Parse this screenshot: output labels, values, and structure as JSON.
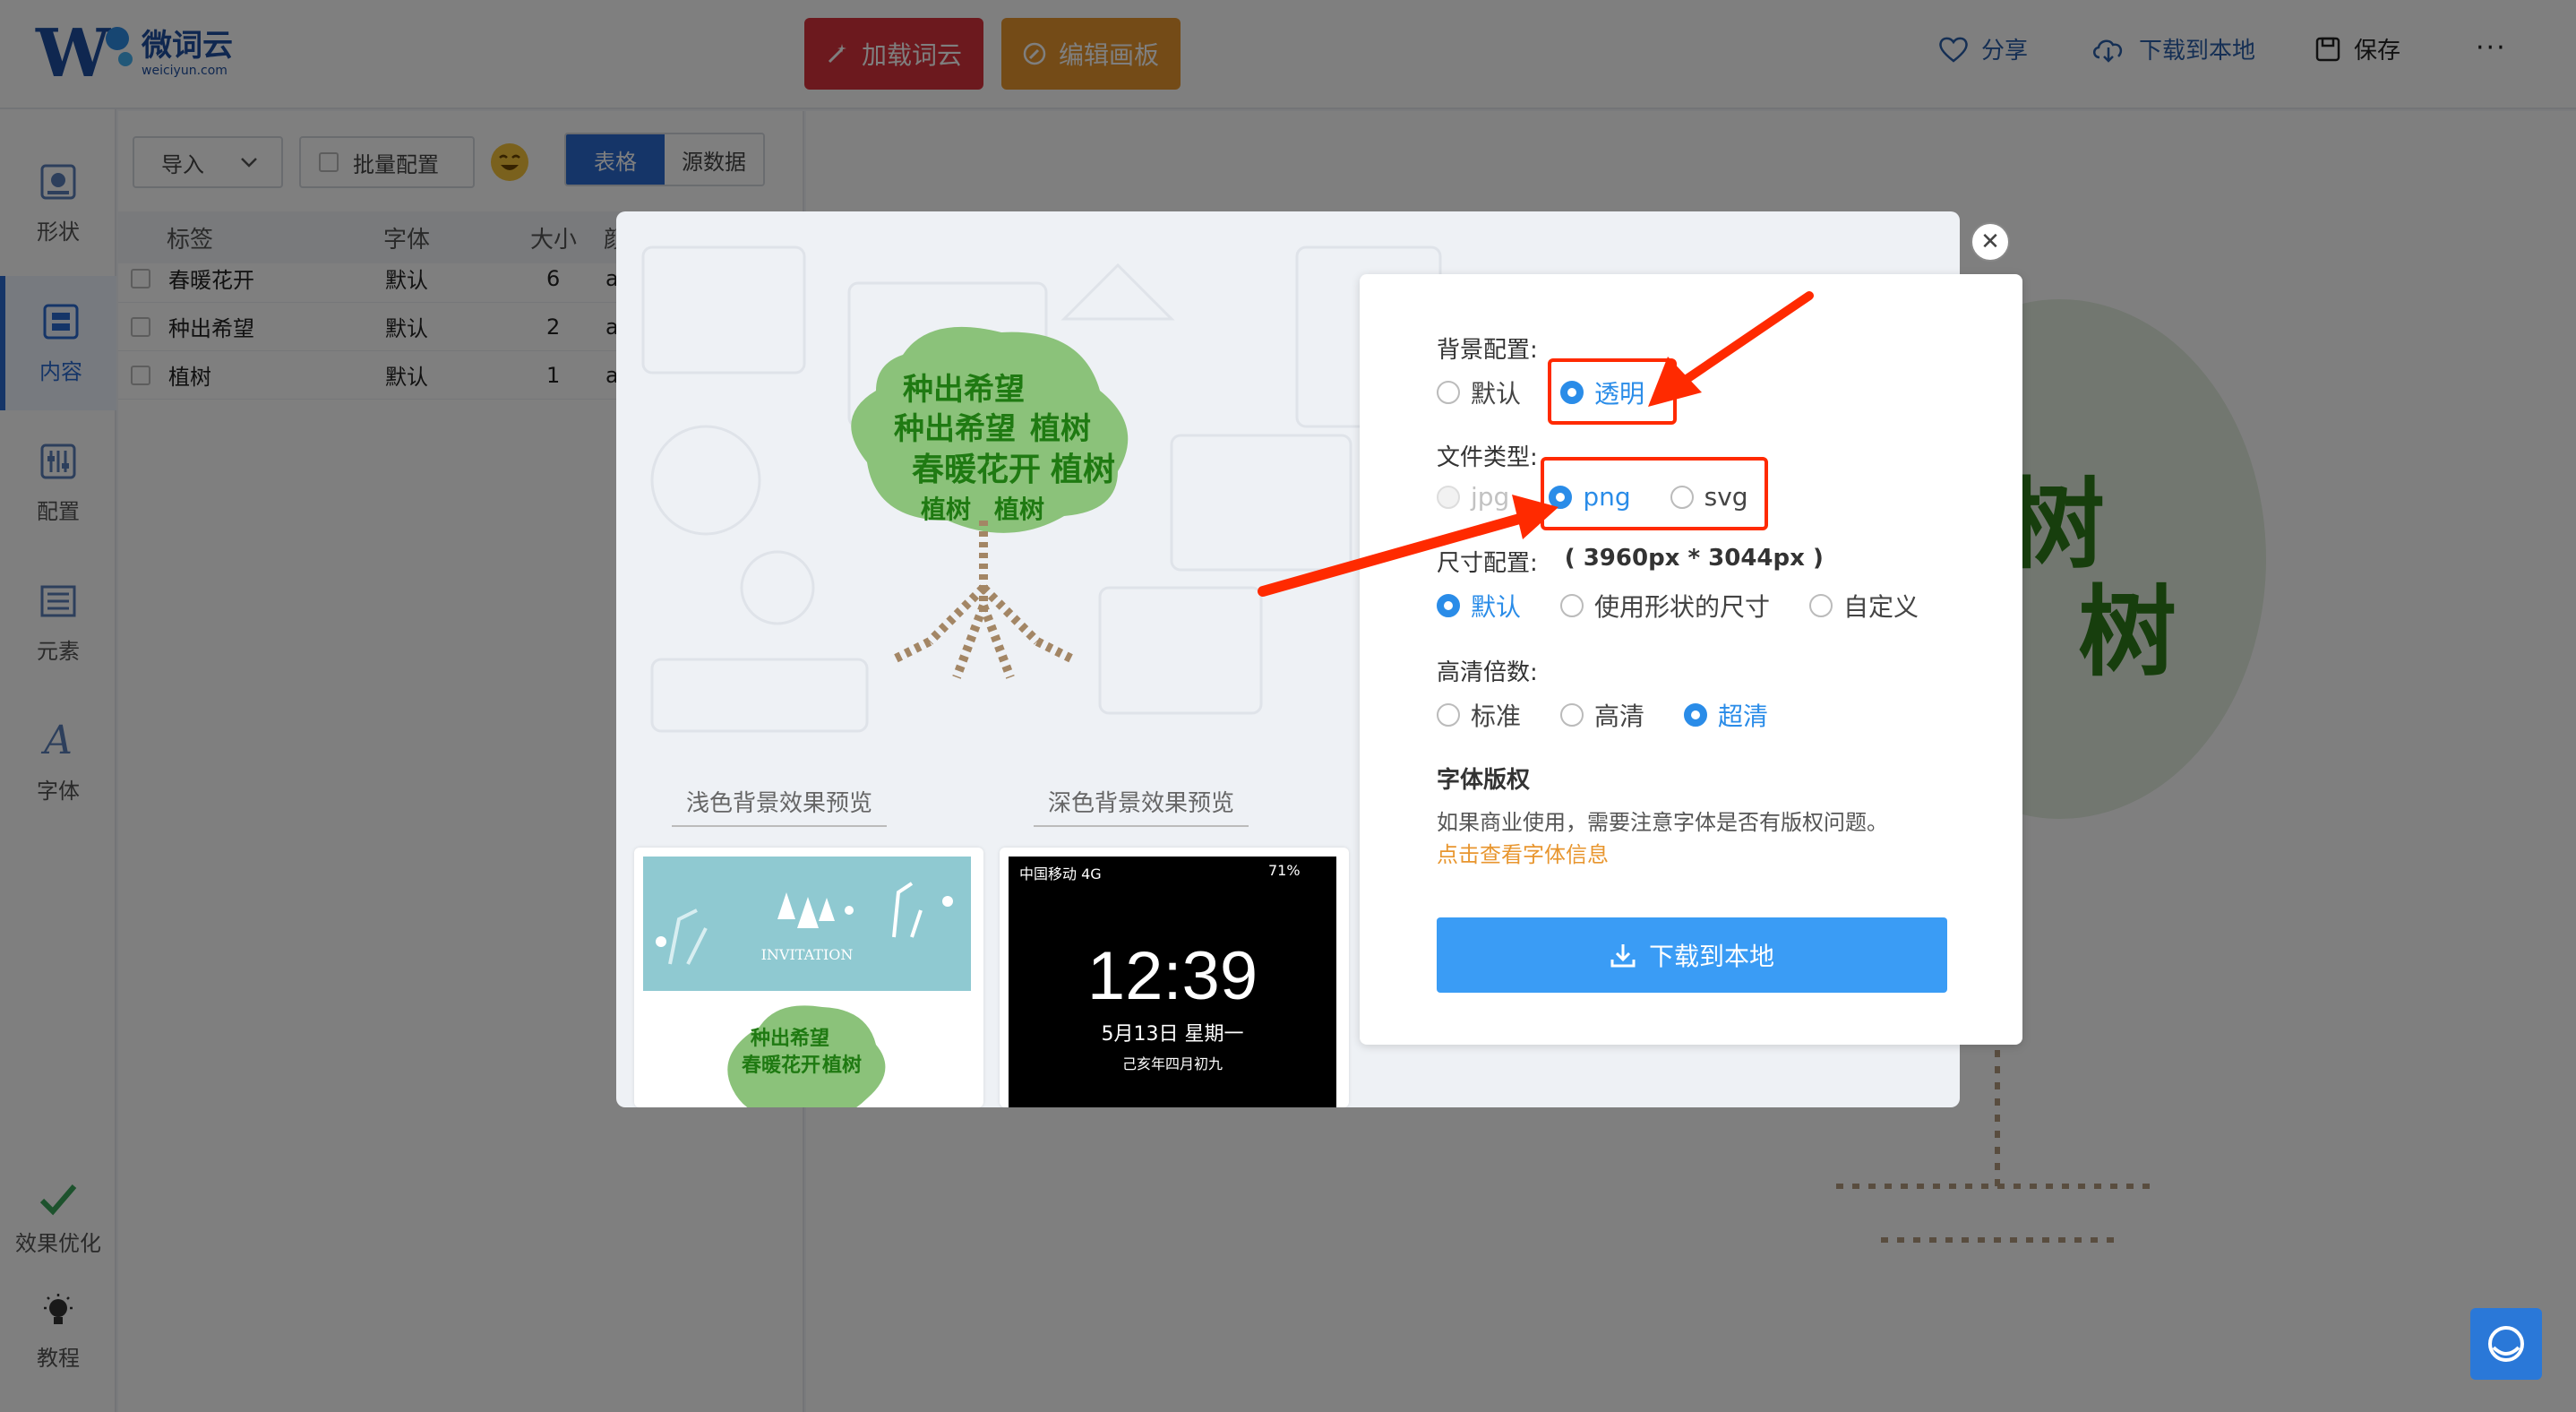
{
  "app": {
    "brand_cn": "微词云",
    "brand_en": "weiciyun.com"
  },
  "toolbar": {
    "load_label": "加载词云",
    "edit_label": "编辑画板",
    "share_label": "分享",
    "download_label": "下载到本地",
    "save_label": "保存",
    "more_label": "···"
  },
  "nav": {
    "items": [
      {
        "label": "形状",
        "icon": "shape-icon"
      },
      {
        "label": "内容",
        "icon": "content-icon"
      },
      {
        "label": "配置",
        "icon": "config-icon"
      },
      {
        "label": "元素",
        "icon": "element-icon"
      },
      {
        "label": "字体",
        "icon": "font-icon"
      }
    ],
    "optimize_label": "效果优化",
    "tutorial_label": "教程"
  },
  "panel": {
    "import_label": "导入",
    "batch_label": "批量配置",
    "tab_table": "表格",
    "tab_source": "源数据",
    "columns": [
      "标签",
      "字体",
      "大小",
      "颜"
    ],
    "rows": [
      {
        "tag": "春暖花开",
        "font": "默认",
        "size": "6",
        "color": "a"
      },
      {
        "tag": "种出希望",
        "font": "默认",
        "size": "2",
        "color": "a"
      },
      {
        "tag": "植树",
        "font": "默认",
        "size": "1",
        "color": "a"
      }
    ]
  },
  "preview": {
    "light_label": "浅色背景效果预览",
    "dark_label": "深色背景效果预览",
    "invitation": "INVITATION",
    "phone_carrier": "中国移动  4G",
    "phone_battery": "71%",
    "phone_time": "12:39",
    "phone_date": "5月13日 星期一",
    "phone_lunar": "己亥年四月初九",
    "tree_words": [
      "种出希望",
      "种出希望",
      "植树",
      "春暖花开",
      "植树",
      "植树",
      "植树"
    ]
  },
  "settings": {
    "bg_title": "背景配置:",
    "bg_options": [
      "默认",
      "透明"
    ],
    "bg_selected": "透明",
    "filetype_title": "文件类型:",
    "filetype_options": [
      "jpg",
      "png",
      "svg"
    ],
    "filetype_selected": "png",
    "filetype_disabled": "jpg",
    "size_title": "尺寸配置:",
    "size_value": "( 3960px * 3044px )",
    "size_options": [
      "默认",
      "使用形状的尺寸",
      "自定义"
    ],
    "size_selected": "默认",
    "hd_title": "高清倍数:",
    "hd_options": [
      "标准",
      "高清",
      "超清"
    ],
    "hd_selected": "超清",
    "copyright_title": "字体版权",
    "copyright_text": "如果商业使用，需要注意字体是否有版权问题。",
    "copyright_link": "点击查看字体信息",
    "download_button": "下载到本地"
  },
  "colors": {
    "accent": "#2a8ce8",
    "load_button": "#d8333d",
    "edit_button": "#e8962f",
    "annotation": "#ff2a00",
    "tree_green": "#2e8b1e",
    "tree_brown": "#8a6a4a"
  }
}
